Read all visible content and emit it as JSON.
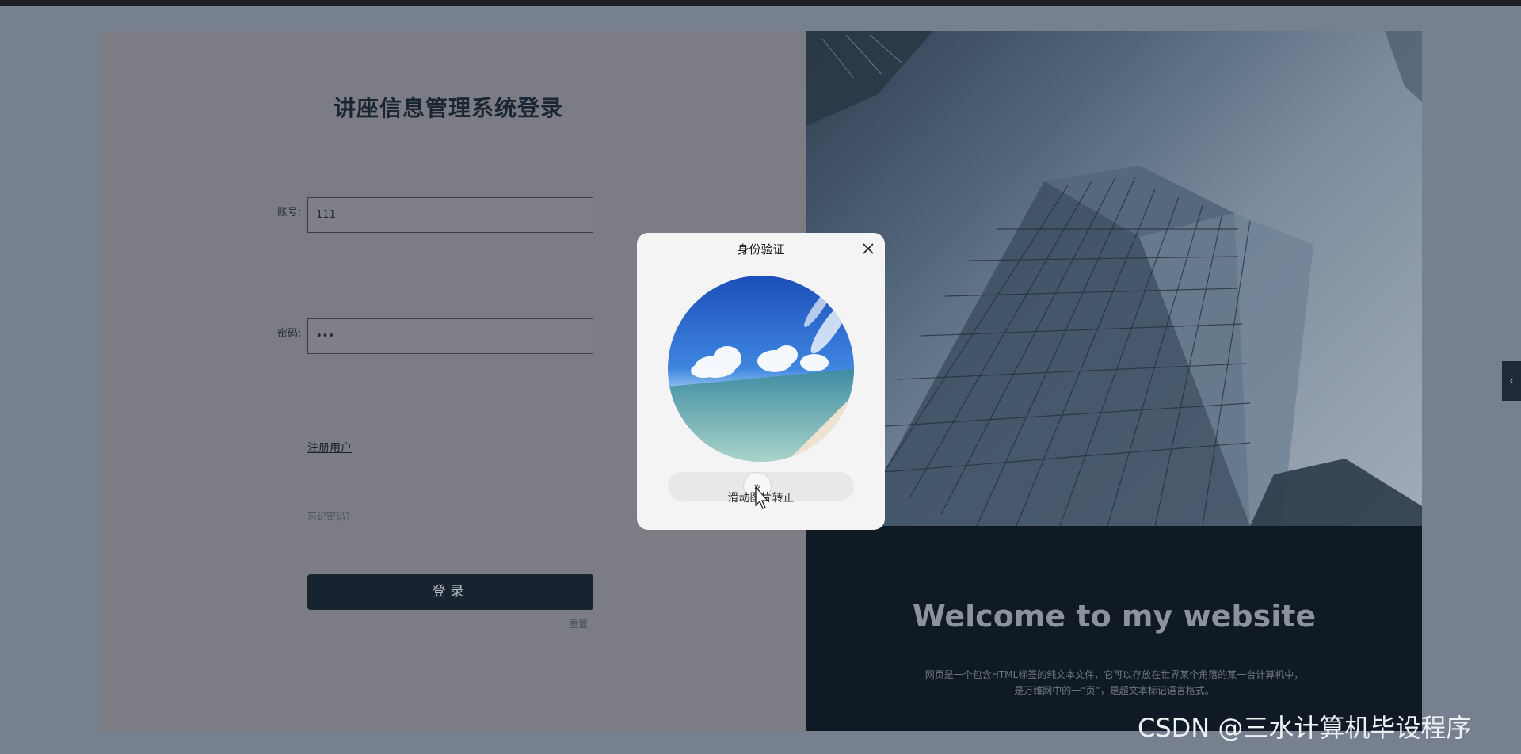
{
  "login": {
    "title": "讲座信息管理系统登录",
    "account_label": "账号:",
    "account_value": "111",
    "password_label": "密码:",
    "password_value": "•••",
    "register_link": "注册用户",
    "forgot_link": "忘记密码?",
    "login_button": "登录",
    "reset_link": "重置"
  },
  "welcome": {
    "title": "Welcome to my website",
    "line1": "网页是一个包含HTML标签的纯文本文件，它可以存放在世界某个角落的某一台计算机中，",
    "line2": "是万维网中的一“页”，是超文本标记语言格式。"
  },
  "modal": {
    "title": "身份验证",
    "slider_hint": "滑动图片转正",
    "slider_icon": "»"
  },
  "side_tab": {
    "icon": "‹"
  },
  "watermark": "CSDN @三水计算机毕设程序"
}
